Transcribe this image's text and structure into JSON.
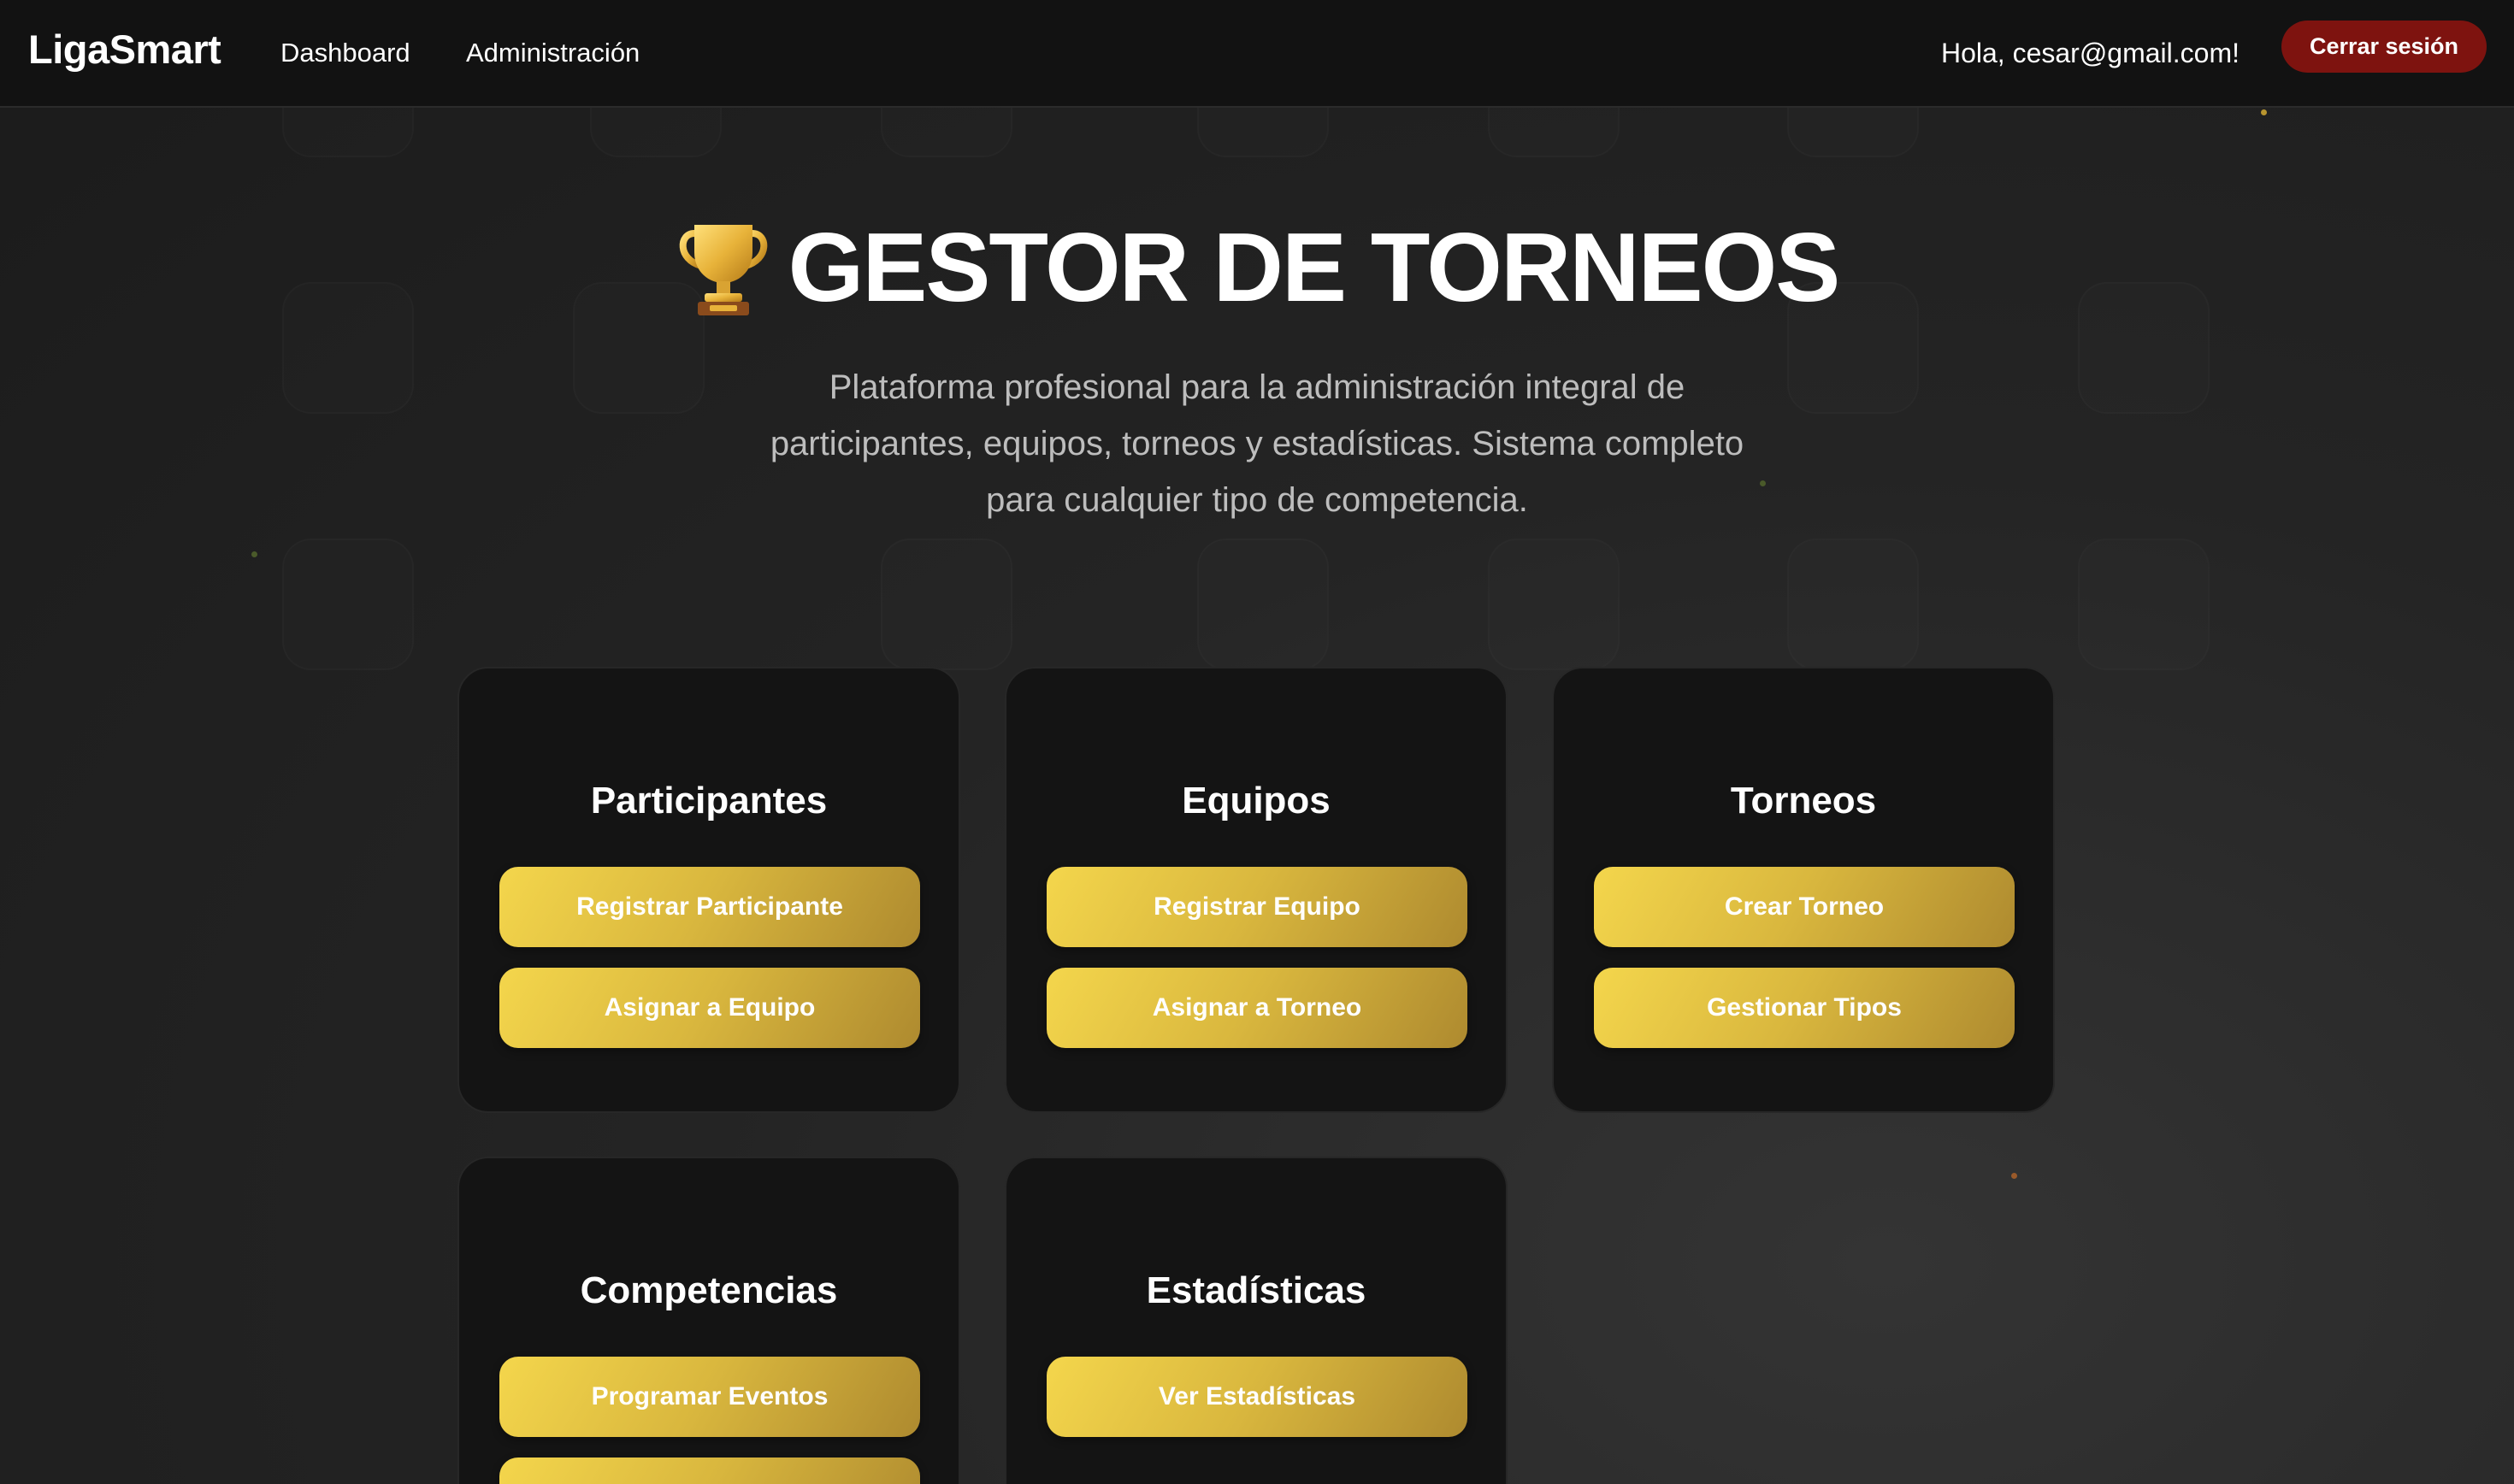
{
  "navbar": {
    "brand": "LigaSmart",
    "links": [
      "Dashboard",
      "Administración"
    ],
    "greeting": "Hola, cesar@gmail.com!",
    "logout_label": "Cerrar sesión"
  },
  "hero": {
    "icon": "trophy-icon",
    "title": "GESTOR DE TORNEOS",
    "subtitle": "Plataforma profesional para la administración integral de participantes, equipos, torneos y estadísticas. Sistema completo para cualquier tipo de competencia."
  },
  "cards": [
    {
      "title": "Participantes",
      "buttons": [
        "Registrar Participante",
        "Asignar a Equipo"
      ]
    },
    {
      "title": "Equipos",
      "buttons": [
        "Registrar Equipo",
        "Asignar a Torneo"
      ]
    },
    {
      "title": "Torneos",
      "buttons": [
        "Crear Torneo",
        "Gestionar Tipos"
      ]
    },
    {
      "title": "Competencias",
      "buttons": [
        "Programar Eventos",
        ""
      ]
    },
    {
      "title": "Estadísticas",
      "buttons": [
        "Ver Estadísticas"
      ]
    }
  ],
  "colors": {
    "accent_gold": "#e8c547",
    "logout_red": "#7e130f",
    "card_bg": "#141414",
    "page_bg": "#1f1f1f"
  }
}
